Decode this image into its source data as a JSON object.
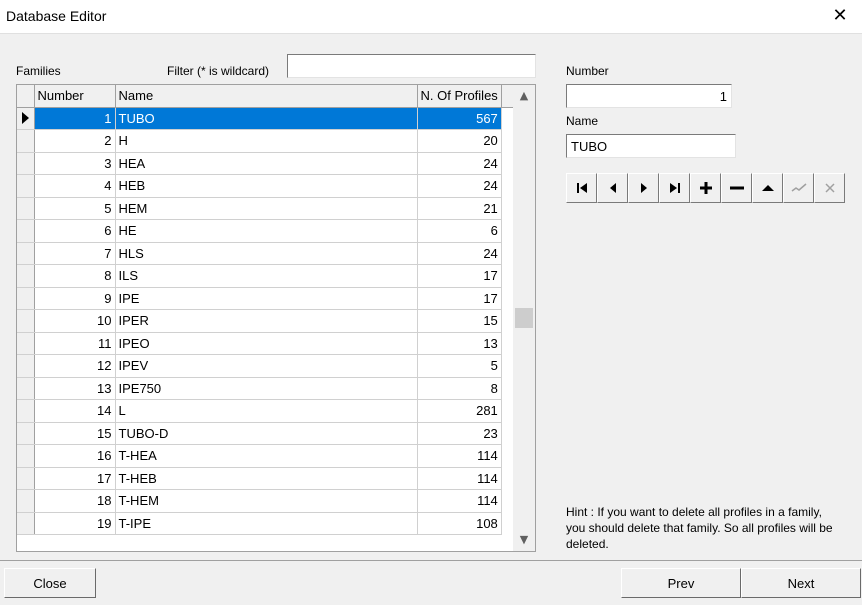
{
  "window": {
    "title": "Database Editor",
    "close_glyph": "✕"
  },
  "families": {
    "label": "Families",
    "filter_label": "Filter (* is wildcard)",
    "filter_value": "",
    "columns": [
      "Number",
      "Name",
      "N. Of Profiles"
    ],
    "rows": [
      {
        "number": "1",
        "name": "TUBO",
        "count": "567",
        "selected": true
      },
      {
        "number": "2",
        "name": "H",
        "count": "20"
      },
      {
        "number": "3",
        "name": "HEA",
        "count": "24"
      },
      {
        "number": "4",
        "name": "HEB",
        "count": "24"
      },
      {
        "number": "5",
        "name": "HEM",
        "count": "21"
      },
      {
        "number": "6",
        "name": "HE",
        "count": "6"
      },
      {
        "number": "7",
        "name": "HLS",
        "count": "24"
      },
      {
        "number": "8",
        "name": "ILS",
        "count": "17"
      },
      {
        "number": "9",
        "name": "IPE",
        "count": "17"
      },
      {
        "number": "10",
        "name": "IPER",
        "count": "15"
      },
      {
        "number": "11",
        "name": "IPEO",
        "count": "13"
      },
      {
        "number": "12",
        "name": "IPEV",
        "count": "5"
      },
      {
        "number": "13",
        "name": "IPE750",
        "count": "8"
      },
      {
        "number": "14",
        "name": "L",
        "count": "281"
      },
      {
        "number": "15",
        "name": "TUBO-D",
        "count": "23"
      },
      {
        "number": "16",
        "name": "T-HEA",
        "count": "114"
      },
      {
        "number": "17",
        "name": "T-HEB",
        "count": "114"
      },
      {
        "number": "18",
        "name": "T-HEM",
        "count": "114"
      },
      {
        "number": "19",
        "name": "T-IPE",
        "count": "108"
      }
    ]
  },
  "detail": {
    "number_label": "Number",
    "number_value": "1",
    "name_label": "Name",
    "name_value": "TUBO"
  },
  "navigator": {
    "buttons": [
      {
        "id": "first",
        "icon": "first-record-icon",
        "enabled": true
      },
      {
        "id": "prior",
        "icon": "prior-record-icon",
        "enabled": true
      },
      {
        "id": "next",
        "icon": "next-record-icon",
        "enabled": true
      },
      {
        "id": "last",
        "icon": "last-record-icon",
        "enabled": true
      },
      {
        "id": "insert",
        "icon": "plus-icon",
        "enabled": true
      },
      {
        "id": "delete",
        "icon": "minus-icon",
        "enabled": true
      },
      {
        "id": "edit",
        "icon": "triangle-up-icon",
        "enabled": true
      },
      {
        "id": "post",
        "icon": "check-icon",
        "enabled": false
      },
      {
        "id": "cancel",
        "icon": "cancel-x-icon",
        "enabled": false
      }
    ]
  },
  "hint": "Hint : If you want to delete all profiles in a family, you should delete that family. So all profiles will be deleted.",
  "buttons": {
    "close": "Close",
    "prev": "Prev",
    "next": "Next"
  },
  "colors": {
    "selection": "#0078d7",
    "background": "#f0f0f0"
  }
}
